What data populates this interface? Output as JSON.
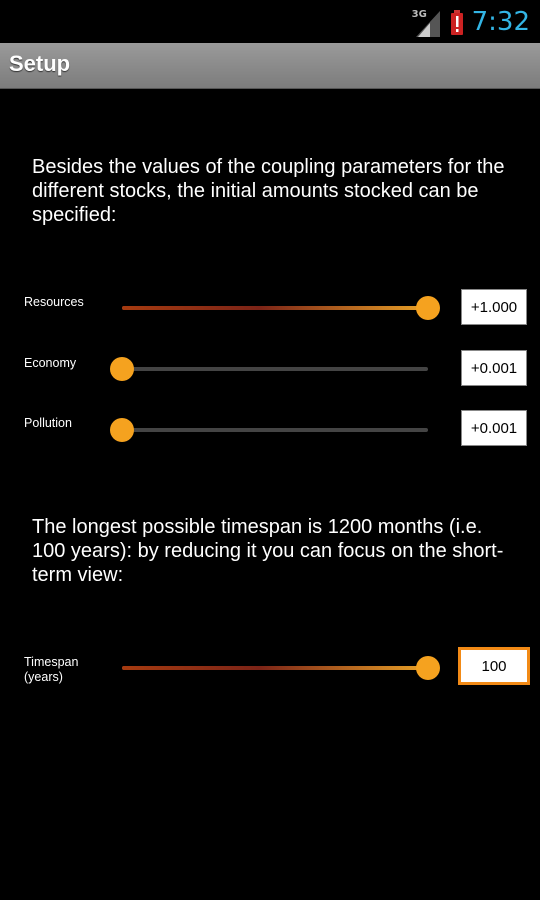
{
  "status_bar": {
    "network": "3G",
    "time": "7:32",
    "icons": [
      "signal-icon",
      "battery-alert-icon"
    ],
    "time_color": "#33b5e5"
  },
  "title_bar": {
    "title": "Setup"
  },
  "intro_text": "Besides the values of the coupling parameters for the different stocks, the initial amounts stocked can be specified:",
  "stocks": [
    {
      "label": "Resources",
      "value": "+1.000",
      "level": 1.0
    },
    {
      "label": "Economy",
      "value": "+0.001",
      "level": 0.0
    },
    {
      "label": "Pollution",
      "value": "+0.001",
      "level": 0.0
    }
  ],
  "timespan_text": "The longest possible timespan is 1200 months (i.e. 100 years): by reducing it you can focus on the short-term view:",
  "timespan": {
    "label": "Timespan\n(years)",
    "value": "100",
    "level": 1.0
  },
  "colors": {
    "accent": "#f5a21f",
    "focus_border": "#f28a16"
  }
}
